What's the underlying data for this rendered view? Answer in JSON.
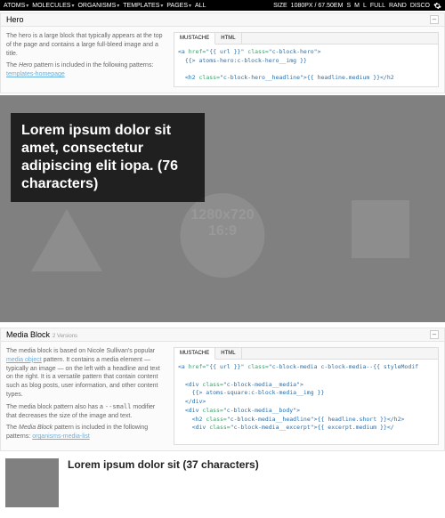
{
  "topbar": {
    "nav": [
      "ATOMS",
      "MOLECULES",
      "ORGANISMS",
      "TEMPLATES",
      "PAGES",
      "ALL"
    ],
    "size_label": "SIZE",
    "size_value": "1080PX / 67.50EM",
    "sizes": [
      "S",
      "M",
      "L",
      "FULL",
      "RAND",
      "DISCO"
    ]
  },
  "hero": {
    "title": "Hero",
    "desc1": "The hero is a large block that typically appears at the top of the page and contains a large full-bleed image and a title.",
    "desc2_a": "The ",
    "desc2_b": "Hero",
    "desc2_c": " pattern is included in the following patterns: ",
    "desc2_link": "templates-homepage",
    "tabs": {
      "mustache": "MUSTACHE",
      "html": "HTML"
    },
    "code_line1": "<a href=\"{{ url }}\" class=\"c-block-hero\">",
    "code_line2": "  {{> atoms-hero:c-block-hero__img }}",
    "code_line3": "  <h2 class=\"c-block-hero__headline\">{{ headline.medium }}</h2>",
    "preview_headline": "Lorem ipsum dolor sit amet, consectetur adipiscing elit iopa. (76 characters)",
    "ph_dim": "1280x720",
    "ph_ratio": "16:9"
  },
  "media": {
    "title": "Media Block",
    "meta": "2 Versions",
    "desc1_a": "The media block is based on Nicole Sullivan's popular ",
    "desc1_link": "media object",
    "desc1_b": " pattern. It contains a media element — typically an image — on the left with a headline and text on the right. It is a versatile pattern that contain content such as blog posts, user information, and other content types.",
    "desc2_a": "The media block pattern also has a ",
    "desc2_code": "--small",
    "desc2_b": " modifier that decreases the size of the image and text.",
    "desc3_a": "The ",
    "desc3_b": "Media Block",
    "desc3_c": " pattern is included in the following patterns: ",
    "desc3_link": "organisms-media-list",
    "tabs": {
      "mustache": "MUSTACHE",
      "html": "HTML"
    },
    "code_line1": "<a href=\"{{ url }}\" class=\"c-block-media c-block-media--{{ styleModif",
    "code_line2": "  <div class=\"c-block-media__media\">",
    "code_line3": "    {{> atoms-square:c-block-media__img }}",
    "code_line4": "  </div>",
    "code_line5": "  <div class=\"c-block-media__body\">",
    "code_line6": "    <h2 class=\"c-block-media__headline\">{{ headline.short }}</h2>",
    "code_line7": "    <div class=\"c-block-media__excerpt\">{{ excerpt.medium }}</",
    "preview_headline": "Lorem ipsum dolor sit (37 characters)"
  }
}
